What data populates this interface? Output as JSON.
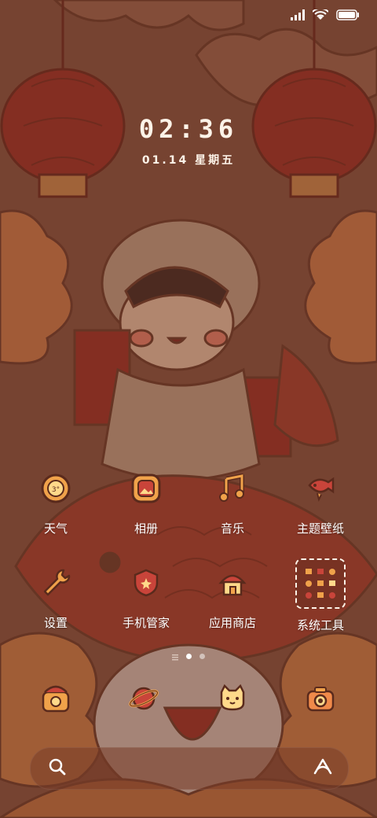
{
  "status_bar": {
    "signal_icon": "signal-bars-icon",
    "wifi_icon": "wifi-icon",
    "battery_icon": "battery-icon"
  },
  "clock": {
    "time": "02:36",
    "date": "01.14 星期五"
  },
  "apps": [
    {
      "label": "天气",
      "icon": "weather-sun-icon"
    },
    {
      "label": "相册",
      "icon": "gallery-icon"
    },
    {
      "label": "音乐",
      "icon": "music-note-icon"
    },
    {
      "label": "主题壁纸",
      "icon": "theme-fish-icon"
    },
    {
      "label": "设置",
      "icon": "wrench-icon"
    },
    {
      "label": "手机管家",
      "icon": "shield-icon"
    },
    {
      "label": "应用商店",
      "icon": "house-icon"
    },
    {
      "label": "系统工具",
      "icon": "folder-icon"
    }
  ],
  "weather_badge": "3°",
  "pages": {
    "current": 2,
    "total": 3
  },
  "dock": [
    {
      "icon": "phone-icon"
    },
    {
      "icon": "browser-planet-icon"
    },
    {
      "icon": "messages-cat-icon"
    },
    {
      "icon": "camera-icon"
    }
  ],
  "search": {
    "icon": "search-icon",
    "assistant_icon": "assistant-icon"
  },
  "colors": {
    "background": "#7a4634",
    "accent": "#f0a24a",
    "red": "#b8342a",
    "cream": "#fdf3e8"
  }
}
